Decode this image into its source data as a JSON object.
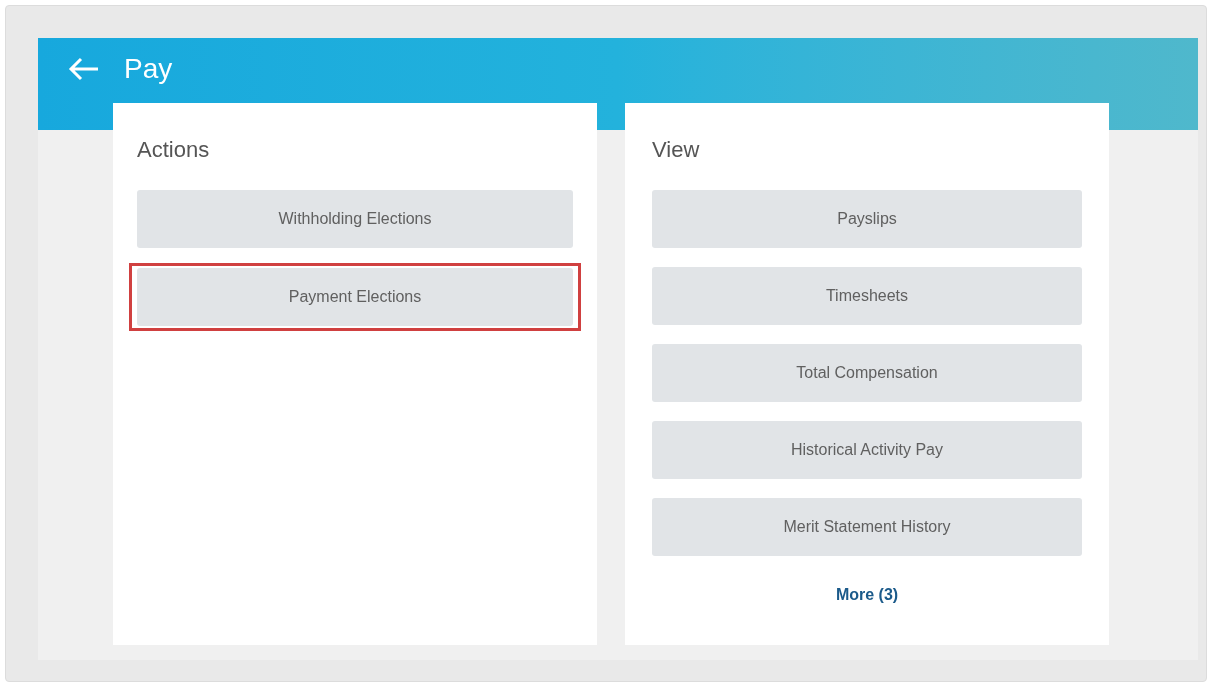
{
  "header": {
    "title": "Pay"
  },
  "actions": {
    "heading": "Actions",
    "items": [
      {
        "label": "Withholding Elections",
        "highlighted": false
      },
      {
        "label": "Payment Elections",
        "highlighted": true
      }
    ]
  },
  "view": {
    "heading": "View",
    "items": [
      {
        "label": "Payslips"
      },
      {
        "label": "Timesheets"
      },
      {
        "label": "Total Compensation"
      },
      {
        "label": "Historical Activity Pay"
      },
      {
        "label": "Merit Statement History"
      }
    ],
    "more_link": "More (3)"
  }
}
